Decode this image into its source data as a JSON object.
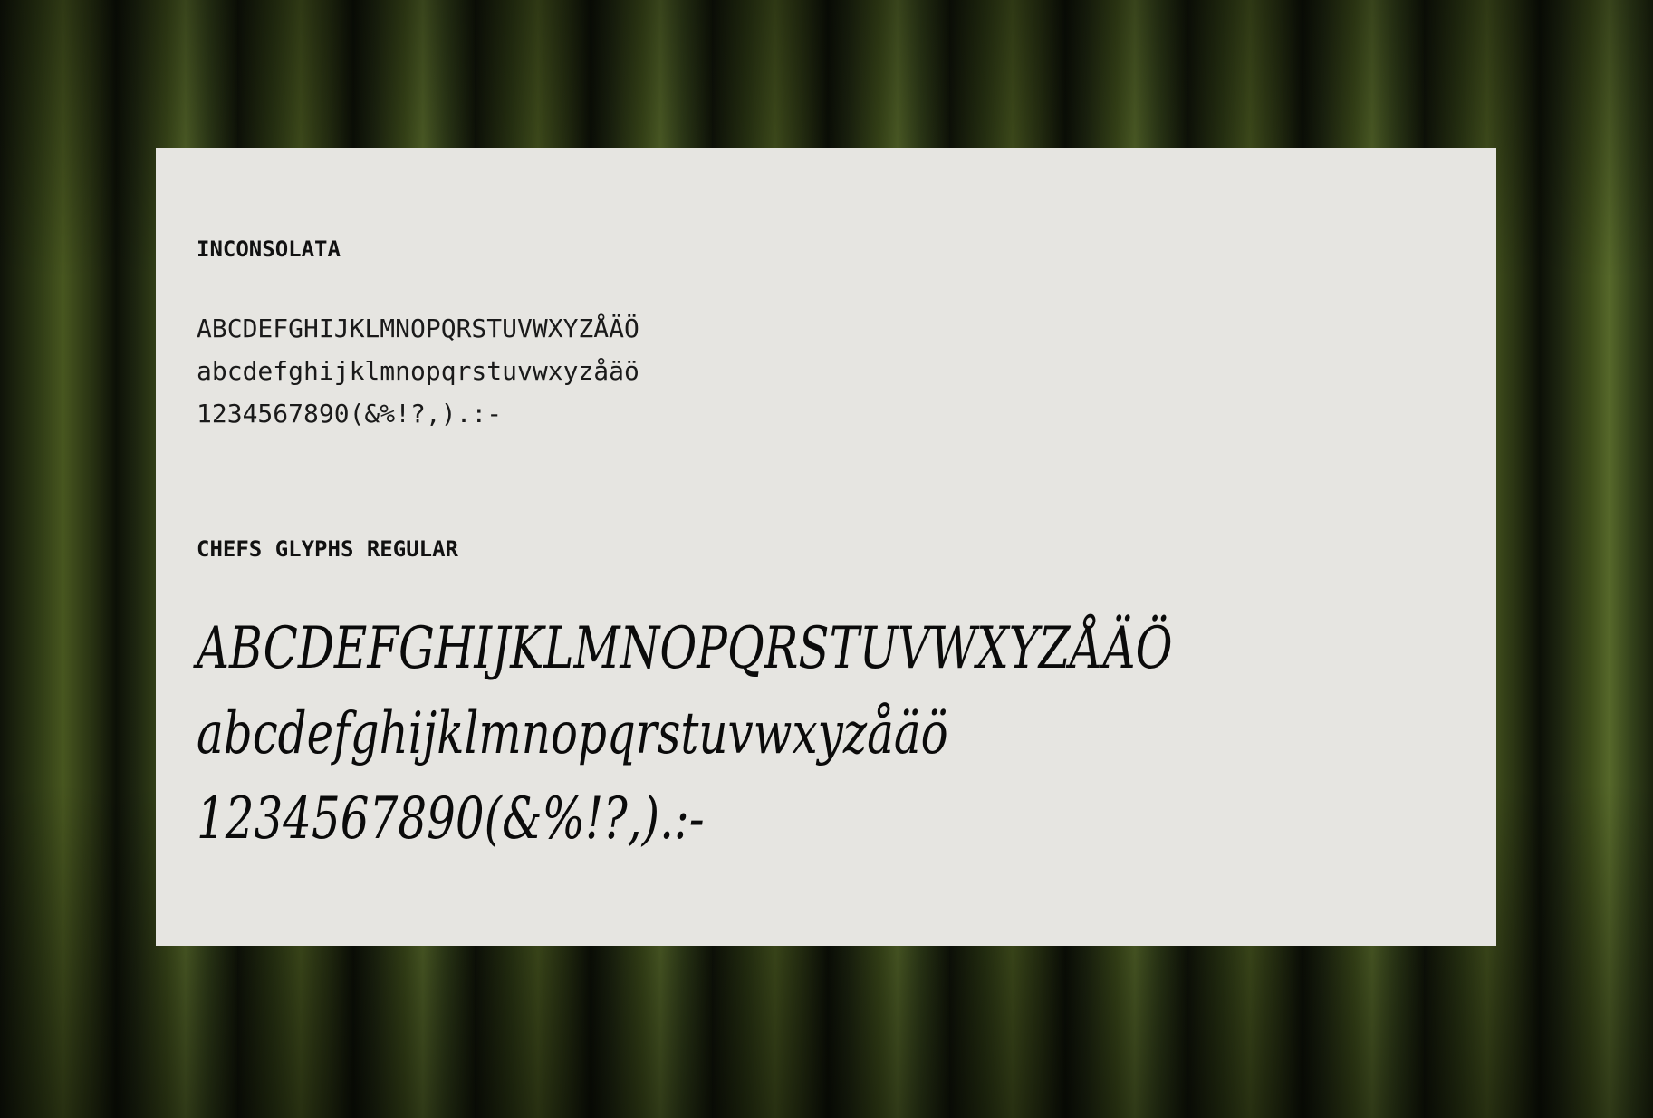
{
  "specimens": [
    {
      "title": "INCONSOLATA",
      "lines": [
        "ABCDEFGHIJKLMNOPQRSTUVWXYZÅÄÖ",
        "abcdefghijklmnopqrstuvwxyzåäö",
        "1234567890(&%!?,).:-"
      ]
    },
    {
      "title": "CHEFS GLYPHS REGULAR",
      "lines": [
        "ABCDEFGHIJKLMNOPQRSTUVWXYZÅÄÖ",
        "abcdefghijklmnopqrstuvwxyzåäö",
        "1234567890(&%!?,).:-"
      ]
    }
  ]
}
